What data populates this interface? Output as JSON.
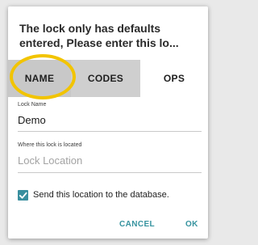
{
  "dialog": {
    "title_line1": "The lock only has defaults",
    "title_line2": "entered, Please enter this lo..."
  },
  "tabs": [
    {
      "label": "NAME"
    },
    {
      "label": "CODES"
    },
    {
      "label": "OPS"
    }
  ],
  "fields": {
    "lock_name": {
      "label": "Lock Name",
      "value": "Demo"
    },
    "location": {
      "label": "Where this lock is located",
      "value": "",
      "placeholder": "Lock Location"
    }
  },
  "send_location": {
    "label": "Send this location to the database.",
    "checked": true
  },
  "actions": {
    "cancel_label": "CANCEL",
    "ok_label": "OK"
  },
  "colors": {
    "accent": "#36939f",
    "highlight": "#f2c400",
    "tab_bg": "#cfcfcf"
  },
  "icons": {
    "checkbox": "checkmark-icon"
  }
}
